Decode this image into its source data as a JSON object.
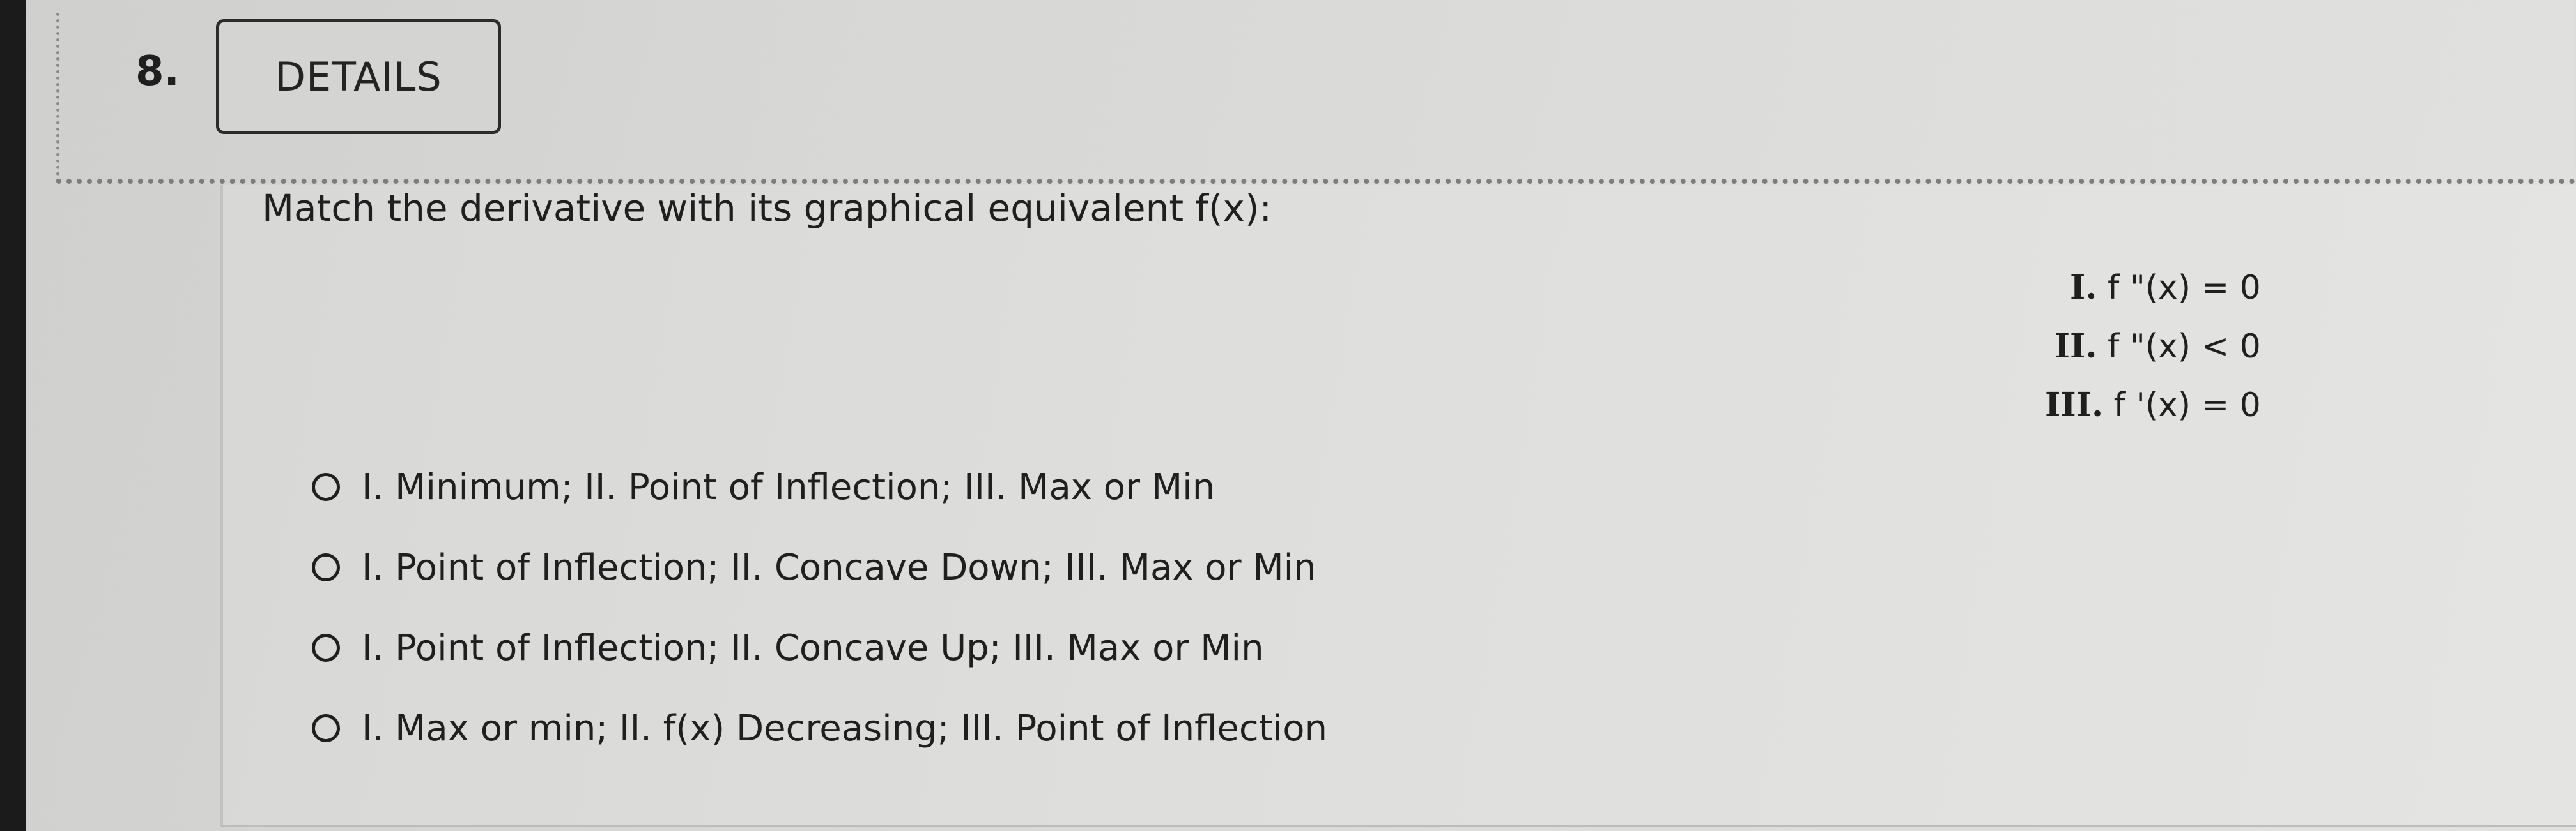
{
  "question": {
    "number": "8.",
    "details_label": "DETAILS",
    "prompt": "Match the derivative with its graphical equivalent f(x):"
  },
  "derivatives": [
    {
      "numeral": "I.",
      "expr": "f \"(x) = 0"
    },
    {
      "numeral": "II.",
      "expr": "f \"(x) < 0"
    },
    {
      "numeral": "III.",
      "expr": "f '(x) = 0"
    }
  ],
  "choices": [
    "I. Minimum; II. Point of Inflection; III. Max or Min",
    "I. Point of Inflection; II. Concave Down; III. Max or Min",
    "I. Point of Inflection; II. Concave Up; III. Max or Min",
    "I. Max or min; II. f(x) Decreasing; III. Point of Inflection"
  ],
  "colors": {
    "background": "#d8d8d6",
    "text": "#1f1f1f",
    "border": "#2b2b2b"
  }
}
